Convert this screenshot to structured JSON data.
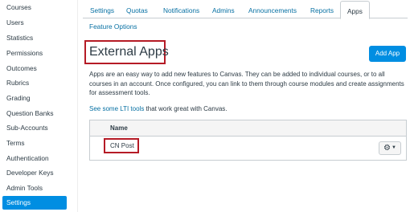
{
  "sidebar": {
    "items": [
      {
        "label": "Courses"
      },
      {
        "label": "Users"
      },
      {
        "label": "Statistics"
      },
      {
        "label": "Permissions"
      },
      {
        "label": "Outcomes"
      },
      {
        "label": "Rubrics"
      },
      {
        "label": "Grading"
      },
      {
        "label": "Question Banks"
      },
      {
        "label": "Sub-Accounts"
      },
      {
        "label": "Terms"
      },
      {
        "label": "Authentication"
      },
      {
        "label": "Developer Keys"
      },
      {
        "label": "Admin Tools"
      },
      {
        "label": "Settings",
        "active": true
      }
    ]
  },
  "tabs": [
    {
      "label": "Settings"
    },
    {
      "label": "Quotas"
    },
    {
      "label": "Notifications"
    },
    {
      "label": "Admins"
    },
    {
      "label": "Announcements"
    },
    {
      "label": "Reports"
    },
    {
      "label": "Apps",
      "active": true
    },
    {
      "label": "Feature Options"
    }
  ],
  "header": {
    "title": "External Apps",
    "add_button": "Add App"
  },
  "description": "Apps are an easy way to add new features to Canvas. They can be added to individual courses, or to all courses in an account. Once configured, you can link to them through course modules and create assignments for assessment tools.",
  "lti": {
    "link_text": "See some LTI tools",
    "suffix": " that work great with Canvas."
  },
  "table": {
    "column_name": "Name",
    "rows": [
      {
        "name": "CN Post"
      }
    ]
  },
  "icons": {
    "gear": "gear-icon",
    "caret": "caret-down-icon"
  },
  "colors": {
    "accent": "#008ee2",
    "link": "#0770a3",
    "highlight_box": "#b51b26"
  }
}
